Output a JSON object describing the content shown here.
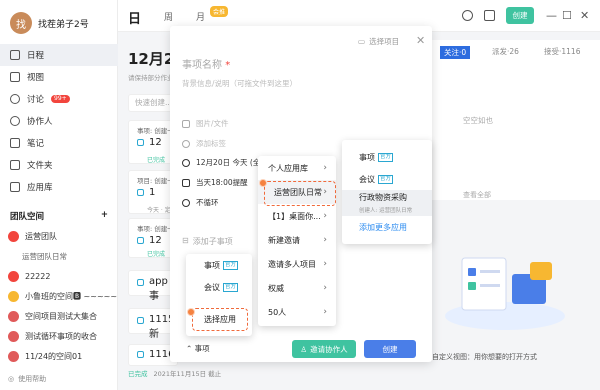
{
  "user": {
    "name": "找茬弟子2号",
    "avatar_char": "找"
  },
  "nav": [
    {
      "label": "日程",
      "icon": "calendar-icon",
      "active": true
    },
    {
      "label": "视图",
      "icon": "view-icon"
    },
    {
      "label": "讨论",
      "icon": "chat-icon",
      "badge": "99+"
    },
    {
      "label": "协作人",
      "icon": "user-icon"
    },
    {
      "label": "笔记",
      "icon": "note-icon"
    },
    {
      "label": "文件夹",
      "icon": "folder-icon"
    },
    {
      "label": "应用库",
      "icon": "apps-icon"
    }
  ],
  "team": {
    "heading": "团队空间",
    "items": [
      {
        "label": "运营团队",
        "color": "#f2453d"
      },
      {
        "label": "运营团队日常",
        "sub": true
      },
      {
        "label": "22222",
        "color": "#f2453d"
      },
      {
        "label": "小鲁班的空间🅱 ~~~~~",
        "color": "#f7b731"
      },
      {
        "label": "空间项目测试大集合",
        "color": "#e05a5a"
      },
      {
        "label": "测试循环事项的收合",
        "color": "#e05a5a"
      },
      {
        "label": "11/24的空间01",
        "color": "#e05a5a"
      }
    ]
  },
  "feedback": "使用帮助",
  "topbar": {
    "logo": "日",
    "week": "周",
    "month": "月",
    "vip": "会推",
    "create": "创建"
  },
  "main": {
    "date_title": "12月2",
    "date_sub": "请保持部分作业",
    "quick_add": "快速创建...",
    "cards": [
      {
        "title": "事项: 创建一",
        "num": "12",
        "tag": "已完成"
      },
      {
        "title": "项目: 创建一",
        "num": "1",
        "tag": "今天 · 定时"
      },
      {
        "title": "事项: 创建一",
        "num": "12",
        "tag": "已完成"
      },
      {
        "title": "",
        "num": "app事",
        "tag": "已完成"
      },
      {
        "title": "",
        "num": "1115新",
        "tag": "已完成"
      },
      {
        "title": "",
        "num": "1116",
        "tag": "已完成"
      }
    ],
    "status": {
      "tag": "已完成",
      "date": "2021年11月15日 截止"
    }
  },
  "right_panel": {
    "tabs": [
      "关注·0",
      "派发·26",
      "接受·1116"
    ],
    "empty": "空空如也",
    "view_all": "查看全部",
    "custom_view": "自定义视图：用你想要的打开方式"
  },
  "modal": {
    "select_project": "选择项目",
    "name_placeholder": "事项名称",
    "required_mark": "*",
    "desc_placeholder": "背景信息/说明（可拖文件到这里）",
    "images": "图片/文件",
    "tags": "添加标签",
    "date": "12月20日 今天 (全",
    "reminder": "当天18:00提醒",
    "repeat": "不循环",
    "add_sub": "添加子事项",
    "footer_type": "事项",
    "invite": "邀请协作人",
    "create": "创建"
  },
  "menu_left": {
    "items": [
      {
        "label": "事项",
        "official": "官方"
      },
      {
        "label": "会议",
        "official": "官方"
      },
      {
        "label": "选择应用"
      }
    ]
  },
  "menu_mid": {
    "items": [
      "个人应用库",
      "运营团队日常",
      "【1】桌面你...",
      "新建邀请",
      "邀请多人项目",
      "权威",
      "50人"
    ]
  },
  "menu_right": {
    "items": [
      {
        "label": "事项",
        "official": "官方"
      },
      {
        "label": "会议",
        "official": "官方"
      },
      {
        "label": "行政物资采购",
        "sub": "创建人: 运营团队日常"
      },
      {
        "label": "添加更多应用"
      }
    ]
  },
  "colors": {
    "accent_green": "#3fc3a0",
    "accent_blue": "#4a7ee8",
    "highlight": "#f06a3b"
  }
}
